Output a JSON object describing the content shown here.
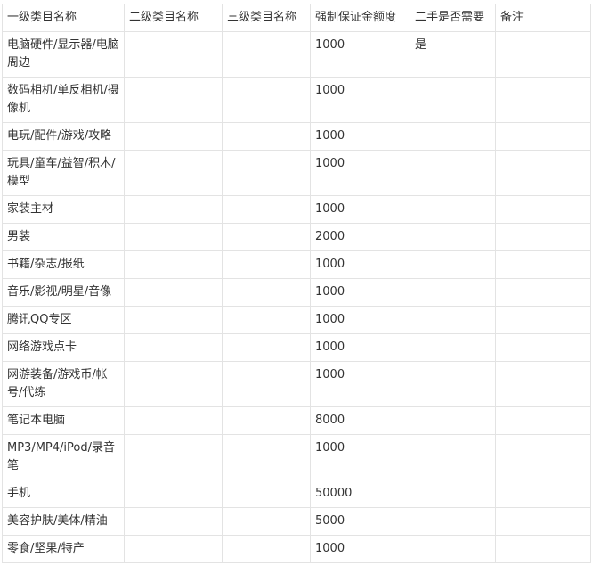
{
  "table": {
    "headers": [
      "一级类目名称",
      "二级类目名称",
      "三级类目名称",
      "强制保证金额度",
      "二手是否需要",
      "备注"
    ],
    "rows": [
      {
        "c1": "电脑硬件/显示器/电脑周边",
        "c2": "",
        "c3": "",
        "c4": "1000",
        "c5": "是",
        "c6": ""
      },
      {
        "c1": "数码相机/单反相机/摄像机",
        "c2": "",
        "c3": "",
        "c4": "1000",
        "c5": "",
        "c6": ""
      },
      {
        "c1": "电玩/配件/游戏/攻略",
        "c2": "",
        "c3": "",
        "c4": "1000",
        "c5": "",
        "c6": ""
      },
      {
        "c1": "玩具/童车/益智/积木/模型",
        "c2": "",
        "c3": "",
        "c4": "1000",
        "c5": "",
        "c6": ""
      },
      {
        "c1": "家装主材",
        "c2": "",
        "c3": "",
        "c4": "1000",
        "c5": "",
        "c6": ""
      },
      {
        "c1": "男装",
        "c2": "",
        "c3": "",
        "c4": "2000",
        "c5": "",
        "c6": ""
      },
      {
        "c1": "书籍/杂志/报纸",
        "c2": "",
        "c3": "",
        "c4": "1000",
        "c5": "",
        "c6": ""
      },
      {
        "c1": "音乐/影视/明星/音像",
        "c2": "",
        "c3": "",
        "c4": "1000",
        "c5": "",
        "c6": ""
      },
      {
        "c1": "腾讯QQ专区",
        "c2": "",
        "c3": "",
        "c4": "1000",
        "c5": "",
        "c6": ""
      },
      {
        "c1": "网络游戏点卡",
        "c2": "",
        "c3": "",
        "c4": "1000",
        "c5": "",
        "c6": ""
      },
      {
        "c1": "网游装备/游戏币/帐号/代练",
        "c2": "",
        "c3": "",
        "c4": "1000",
        "c5": "",
        "c6": ""
      },
      {
        "c1": "笔记本电脑",
        "c2": "",
        "c3": "",
        "c4": "8000",
        "c5": "",
        "c6": ""
      },
      {
        "c1": "MP3/MP4/iPod/录音笔",
        "c2": "",
        "c3": "",
        "c4": "1000",
        "c5": "",
        "c6": ""
      },
      {
        "c1": "手机",
        "c2": "",
        "c3": "",
        "c4": "50000",
        "c5": "",
        "c6": ""
      },
      {
        "c1": "美容护肤/美体/精油",
        "c2": "",
        "c3": "",
        "c4": "5000",
        "c5": "",
        "c6": ""
      },
      {
        "c1": "零食/坚果/特产",
        "c2": "",
        "c3": "",
        "c4": "1000",
        "c5": "",
        "c6": ""
      }
    ]
  }
}
